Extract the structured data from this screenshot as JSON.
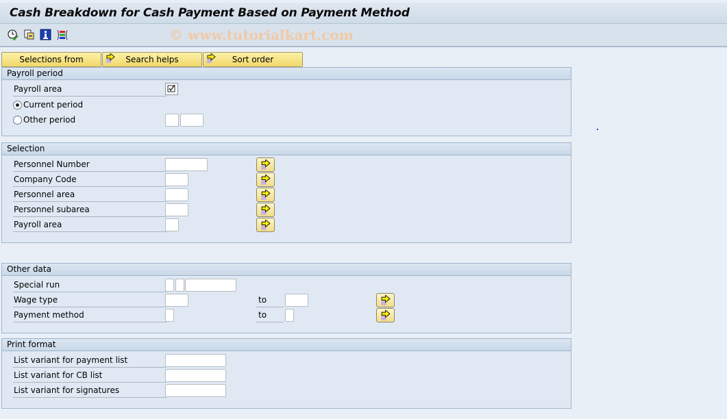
{
  "window": {
    "title": "Cash Breakdown for Cash Payment Based on Payment Method",
    "watermark": "© www.tutorialkart.com"
  },
  "toolbar": {
    "icons": [
      "execute-clock-icon",
      "get-variant-icon",
      "info-icon",
      "selection-options-icon"
    ]
  },
  "buttons": {
    "selections_from": "Selections from",
    "search_helps": "Search helps",
    "sort_order": "Sort order"
  },
  "groups": {
    "payroll_period": {
      "title": "Payroll period",
      "payroll_area_label": "Payroll area",
      "payroll_area_checked": true,
      "current_period_label": "Current period",
      "current_period_selected": true,
      "other_period_label": "Other period",
      "other_period_selected": false,
      "other_period_value_1": "",
      "other_period_value_2": ""
    },
    "selection": {
      "title": "Selection",
      "fields": [
        {
          "label": "Personnel Number",
          "value": ""
        },
        {
          "label": "Company Code",
          "value": ""
        },
        {
          "label": "Personnel area",
          "value": ""
        },
        {
          "label": "Personnel subarea",
          "value": ""
        },
        {
          "label": "Payroll area",
          "value": ""
        }
      ]
    },
    "other_data": {
      "title": "Other data",
      "special_run_label": "Special run",
      "wage_type_label": "Wage type",
      "payment_method_label": "Payment method",
      "to_label": "to"
    },
    "print_format": {
      "title": "Print format",
      "fields": [
        {
          "label": "List variant for payment list",
          "value": ""
        },
        {
          "label": "List variant for CB list",
          "value": ""
        },
        {
          "label": "List variant for signatures",
          "value": ""
        }
      ]
    }
  }
}
